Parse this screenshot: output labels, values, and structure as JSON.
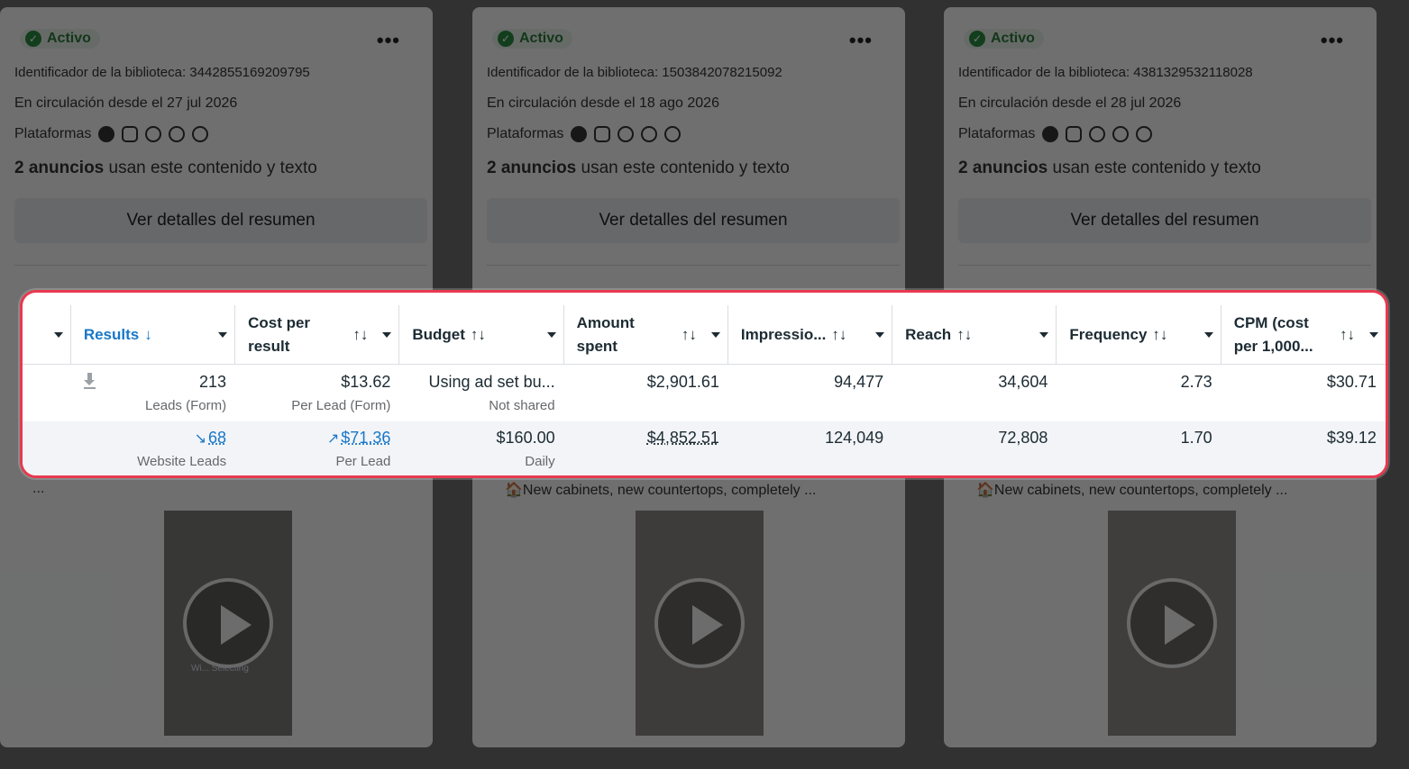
{
  "cards": [
    {
      "status": "Activo",
      "library_id": "Identificador de la biblioteca: 3442855169209795",
      "since": "En circulación desde el 27 jul 2026",
      "platforms_label": "Plataformas",
      "usage_bold": "2 anuncios",
      "usage_rest": " usan este contenido y texto",
      "summary_button": "Ver detalles del resumen",
      "caption": "...",
      "video_text": "Wi... Selecting"
    },
    {
      "status": "Activo",
      "library_id": "Identificador de la biblioteca: 1503842078215092",
      "since": "En circulación desde el 18 ago 2026",
      "platforms_label": "Plataformas",
      "usage_bold": "2 anuncios",
      "usage_rest": " usan este contenido y texto",
      "summary_button": "Ver detalles del resumen",
      "caption": "🏠New cabinets, new countertops, completely ...",
      "video_text": ""
    },
    {
      "status": "Activo",
      "library_id": "Identificador de la biblioteca: 4381329532118028",
      "since": "En circulación desde el 28 jul 2026",
      "platforms_label": "Plataformas",
      "usage_bold": "2 anuncios",
      "usage_rest": " usan este contenido y texto",
      "summary_button": "Ver detalles del resumen",
      "caption": "🏠New cabinets, new countertops, completely ...",
      "video_text": ""
    }
  ],
  "table": {
    "headers": {
      "results": "Results",
      "cost_per_result": "Cost per result",
      "budget": "Budget",
      "amount_spent": "Amount spent",
      "impressions": "Impressio...",
      "reach": "Reach",
      "frequency": "Frequency",
      "cpm": "CPM (cost per 1,000..."
    },
    "sort_icons": {
      "desc": "↓",
      "both": "↑↓"
    },
    "rows": [
      {
        "results": "213",
        "results_sub": "Leads (Form)",
        "cost": "$13.62",
        "cost_sub": "Per Lead (Form)",
        "budget": "Using ad set bu...",
        "budget_sub": "Not shared",
        "spent": "$2,901.61",
        "impressions": "94,477",
        "reach": "34,604",
        "frequency": "2.73",
        "cpm": "$30.71"
      },
      {
        "results": "68",
        "results_sub": "Website Leads",
        "cost": "$71.36",
        "cost_sub": "Per Lead",
        "budget": "$160.00",
        "budget_sub": "Daily",
        "spent": "$4,852.51",
        "impressions": "124,049",
        "reach": "72,808",
        "frequency": "1.70",
        "cpm": "$39.12"
      }
    ],
    "trend_down": "↘",
    "trend_up": "↗"
  },
  "colors": {
    "highlight_border": "#e8394f",
    "link_blue": "#1877c9",
    "active_green": "#2a7a3b"
  }
}
